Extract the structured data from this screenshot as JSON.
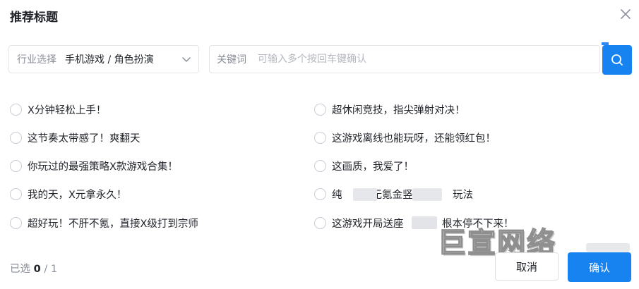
{
  "dialog": {
    "title": "推荐标题",
    "close_icon": "close-icon"
  },
  "filter": {
    "label": "行业选择",
    "value": "手机游戏 / 角色扮演",
    "icon": "chevron-down-icon"
  },
  "keyword": {
    "label": "关键词",
    "value": "",
    "placeholder": "可输入多个按回车键确认"
  },
  "search": {
    "icon": "search-icon",
    "color": "#1683f0"
  },
  "options_left": [
    {
      "label": "X分钟轻松上手！",
      "selected": false
    },
    {
      "label": "这节奏太带感了！爽翻天",
      "selected": false
    },
    {
      "label": "你玩过的最强策略X款游戏合集！",
      "selected": false
    },
    {
      "label": "我的天，X元拿永久！",
      "selected": false
    },
    {
      "label": "超好玩！不肝不氪，直接X级打到宗师",
      "selected": false
    }
  ],
  "options_right": [
    {
      "label": "超休闲竞技，指尖弹射对决！",
      "selected": false
    },
    {
      "label": "这游戏离线也能玩呀，还能领红包！",
      "selected": false
    },
    {
      "label": "这画质，我爱了！",
      "selected": false
    },
    {
      "parts": [
        "纯",
        "无氪金竖屏",
        "玩法"
      ],
      "selected": false
    },
    {
      "parts": [
        "这游戏开局送座",
        "。根本停不下来！"
      ],
      "selected": false
    }
  ],
  "watermark": "巨宣网络",
  "footer": {
    "selected_label": "已选",
    "selected_count": "0",
    "separator": "/",
    "max": "1",
    "cancel_label": "取消",
    "confirm_label": "确认"
  },
  "colors": {
    "primary": "#1683f0",
    "border": "#e3e5e9",
    "muted_text": "#8a8f99"
  }
}
